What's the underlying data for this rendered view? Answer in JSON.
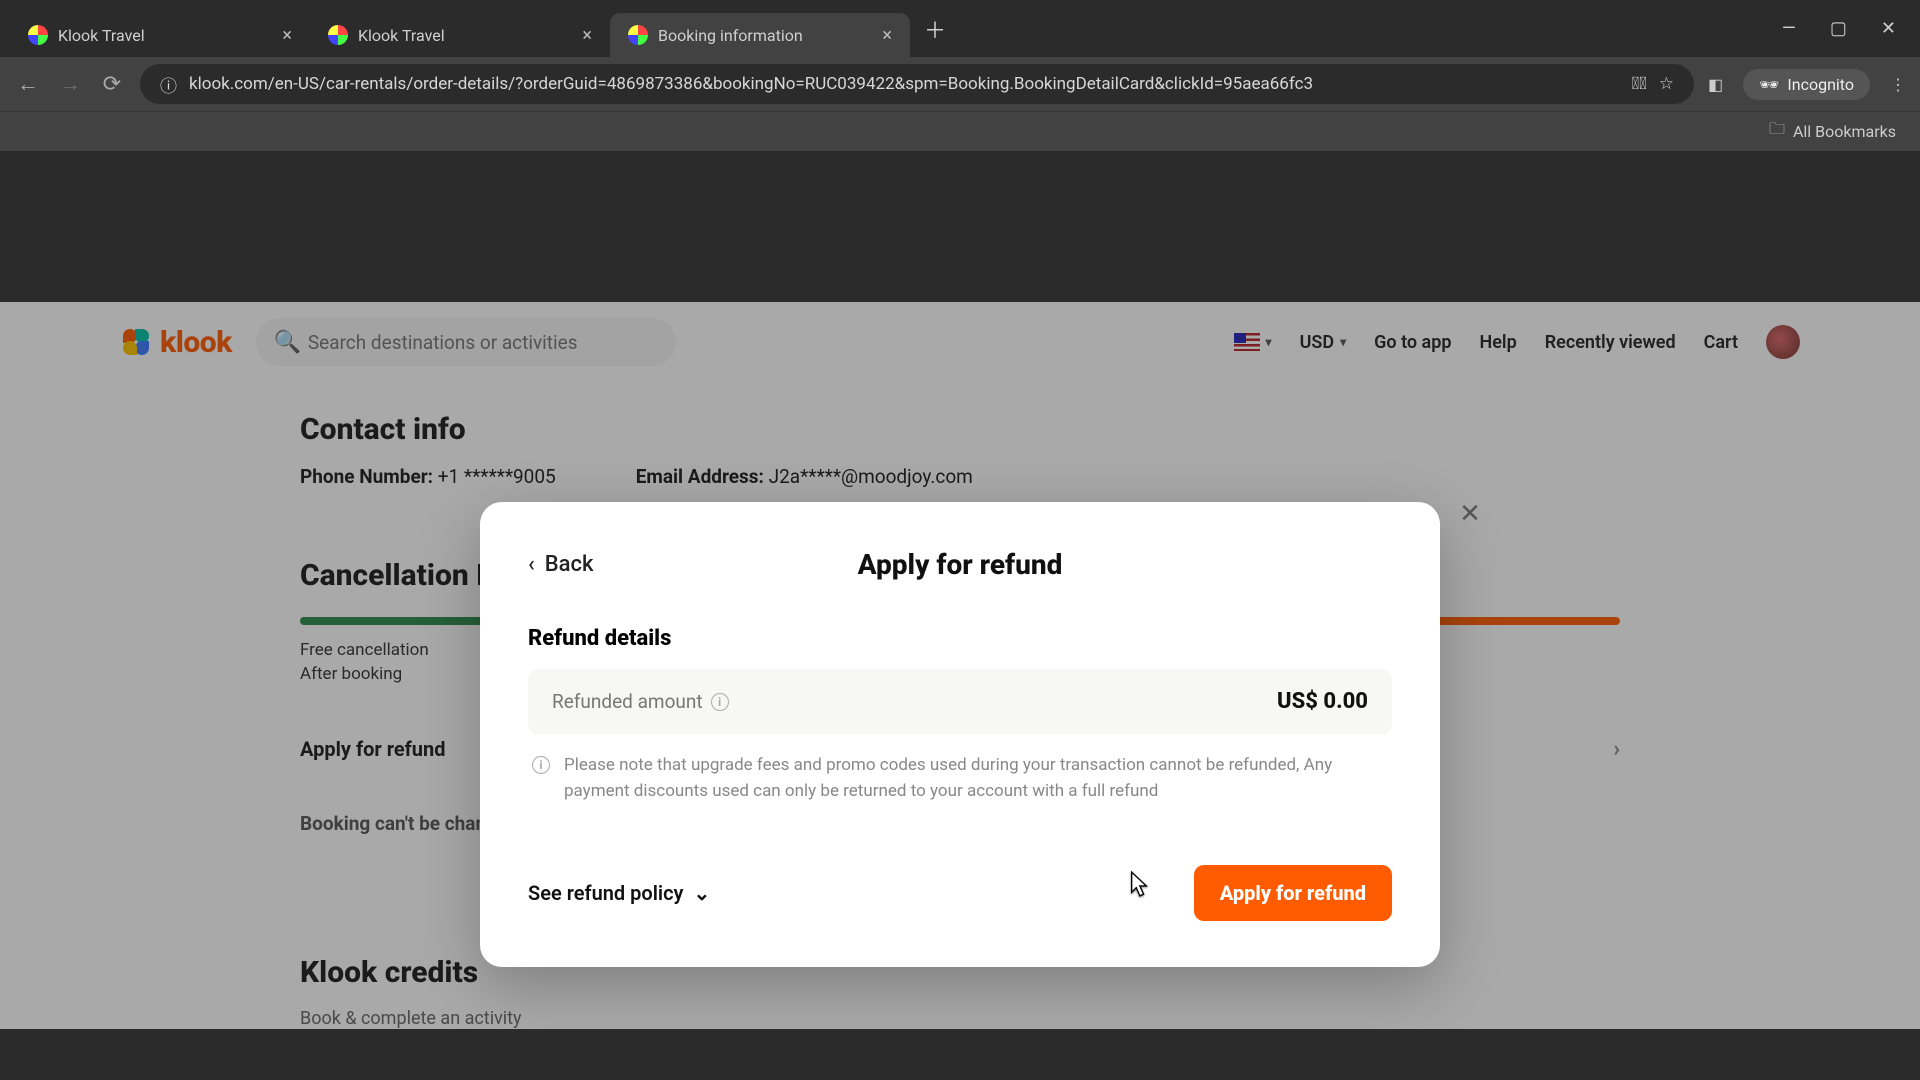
{
  "browser": {
    "tabs": [
      {
        "title": "Klook Travel",
        "active": false
      },
      {
        "title": "Klook Travel",
        "active": false
      },
      {
        "title": "Booking information",
        "active": true
      }
    ],
    "url": "klook.com/en-US/car-rentals/order-details/?orderGuid=4869873386&bookingNo=RUC039422&spm=Booking.BookingDetailCard&clickId=95aea66fc3",
    "incognito_label": "Incognito",
    "bookmarks_label": "All Bookmarks"
  },
  "site_header": {
    "brand": "klook",
    "search_placeholder": "Search destinations or activities",
    "currency": "USD",
    "nav": {
      "go_to_app": "Go to app",
      "help": "Help",
      "recently_viewed": "Recently viewed",
      "cart": "Cart"
    }
  },
  "page": {
    "contact_heading": "Contact info",
    "phone_label": "Phone Number:",
    "phone_value": "+1 ******9005",
    "email_label": "Email Address:",
    "email_value": "J2a*****@moodjoy.com",
    "cancel_heading": "Cancellation Policy",
    "cancel_line1": "Free cancellation",
    "cancel_line2": "After booking",
    "apply_refund_row": "Apply for refund",
    "booking_locked": "Booking can't be changed",
    "credits_heading": "Klook credits",
    "credits_step": "Book & complete an activity"
  },
  "modal": {
    "back": "Back",
    "title": "Apply for refund",
    "section": "Refund details",
    "amount_label": "Refunded amount",
    "amount_value": "US$ 0.00",
    "note": "Please note that upgrade fees and promo codes used during your transaction cannot be refunded, Any payment discounts used can only be returned to your account with a full refund",
    "policy_link": "See refund policy",
    "apply_button": "Apply for refund"
  }
}
